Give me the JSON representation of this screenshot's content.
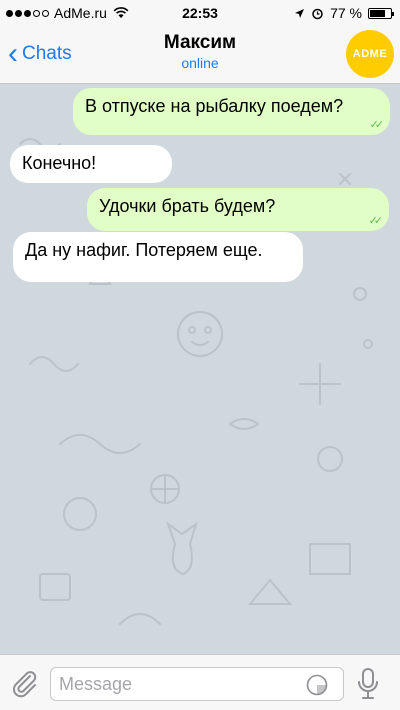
{
  "status_bar": {
    "carrier": "AdMe.ru",
    "time": "22:53",
    "battery": "77 %",
    "battery_level": 0.77
  },
  "nav": {
    "back_label": "Chats",
    "contact_name": "Максим",
    "contact_status": "online",
    "avatar_text": "ADME",
    "avatar_color": "#ffcc00"
  },
  "messages": [
    {
      "direction": "out",
      "text": "В отпуске на рыбалку поедем?",
      "read": true
    },
    {
      "direction": "in",
      "text": "Конечно!"
    },
    {
      "direction": "out",
      "text": "Удочки брать будем?",
      "read": true
    },
    {
      "direction": "in",
      "text": "Да ну нафиг. Потеряем еще."
    }
  ],
  "input": {
    "placeholder": "Message"
  },
  "colors": {
    "accent": "#1a7cf5",
    "outgoing_bubble": "#e1fec6",
    "incoming_bubble": "#ffffff",
    "chat_background": "#cfd8dc",
    "read_check": "#5dbb4b"
  }
}
